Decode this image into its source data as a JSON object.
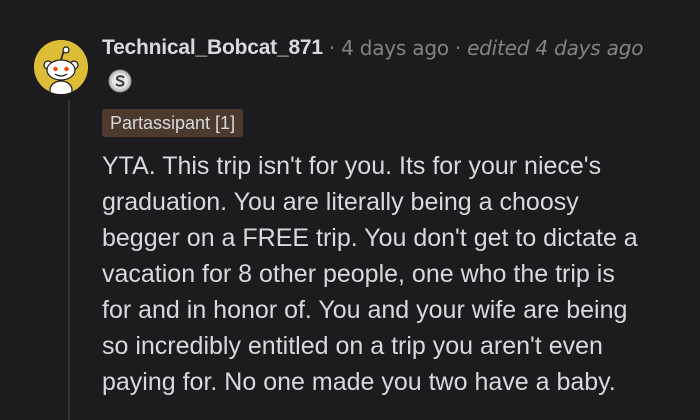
{
  "comment": {
    "username": "Technical_Bobcat_871",
    "separator": "·",
    "time_ago": "4 days ago",
    "edited": "edited 4 days ago",
    "award_icon": "silver-award-icon",
    "flair": "Partassipant [1]",
    "body_lines": [
      "YTA. This trip isn't for you. Its for your niece's",
      "graduation. You are literally being a choosy",
      "begger on a FREE trip. You don't get to dictate a",
      "vacation for 8 other people, one who the trip is",
      "for and in honor of. You and your wife are being",
      "so incredibly entitled on a trip you aren't even",
      "paying for. No one made you two have a baby."
    ]
  },
  "colors": {
    "background": "#1c1c1e",
    "text": "#d7dadc",
    "muted": "#818384",
    "avatar": "#ddbd37",
    "flair_bg": "#4d3a2f",
    "thread_line": "#343536"
  }
}
